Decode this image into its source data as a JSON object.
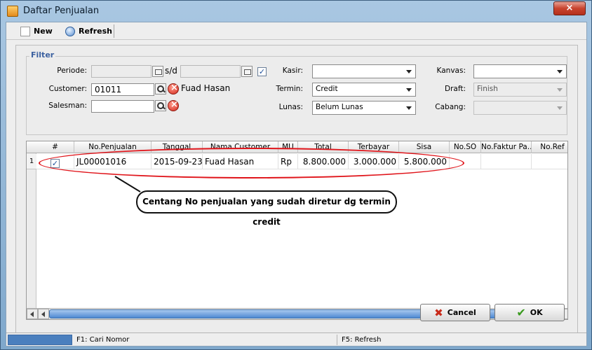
{
  "window": {
    "title": "Daftar Penjualan",
    "close_label": "×"
  },
  "toolbar": {
    "new_label": "New",
    "refresh_label": "Refresh"
  },
  "filter": {
    "legend": "Filter",
    "periode_label": "Periode:",
    "sd_label": "s/d",
    "periode_checked": true,
    "customer_label": "Customer:",
    "customer_code": "01011",
    "customer_name": "Fuad Hasan",
    "salesman_label": "Salesman:",
    "salesman_value": "",
    "kasir_label": "Kasir:",
    "kasir_value": "",
    "termin_label": "Termin:",
    "termin_value": "Credit",
    "lunas_label": "Lunas:",
    "lunas_value": "Belum Lunas",
    "kanvas_label": "Kanvas:",
    "kanvas_value": "",
    "draft_label": "Draft:",
    "draft_value": "Finish",
    "cabang_label": "Cabang:",
    "cabang_value": ""
  },
  "table": {
    "columns": [
      "#",
      "No.Penjualan",
      "Tanggal",
      "Nama Customer",
      "MU",
      "Total",
      "Terbayar",
      "Sisa",
      "No.SO",
      "No.Faktur Pa...",
      "No.Ref"
    ],
    "rows": [
      {
        "index": "1",
        "checked": "✓",
        "no_penjualan": "JL00001016",
        "tanggal": "2015-09-23",
        "nama_customer": "Fuad Hasan",
        "mu": "Rp",
        "total": "8.800.000",
        "terbayar": "3.000.000",
        "sisa": "5.800.000",
        "no_so": "",
        "no_faktur": "",
        "no_ref": ""
      }
    ]
  },
  "annotation": {
    "text": "Centang No penjualan yang sudah diretur dg termin credit"
  },
  "buttons": {
    "cancel_label": "Cancel",
    "ok_label": "OK"
  },
  "statusbar": {
    "f1": "F1: Cari Nomor",
    "f5": "F5: Refresh"
  },
  "colors": {
    "highlight_oval": "#e0141a",
    "accent": "#4a7fbe"
  }
}
